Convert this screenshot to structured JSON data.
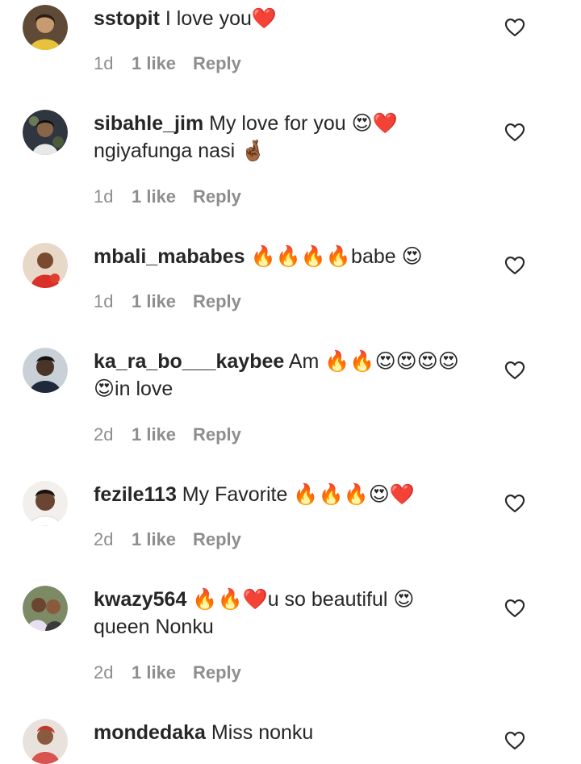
{
  "comments": [
    {
      "username": "sstopit",
      "text": " I love you❤️",
      "time": "1d",
      "likes": "1 like",
      "reply": "Reply",
      "avatar_color": "#7a5a3c"
    },
    {
      "username": "sibahle_jim",
      "text": " My love for you 😍❤️\nngiyafunga nasi 🤞🏾",
      "time": "1d",
      "likes": "1 like",
      "reply": "Reply",
      "avatar_color": "#3a4048"
    },
    {
      "username": "mbali_mababes",
      "text": " 🔥🔥🔥🔥babe 😍",
      "time": "1d",
      "likes": "1 like",
      "reply": "Reply",
      "avatar_color": "#c0392b"
    },
    {
      "username": "ka_ra_bo___kaybee",
      "text": " Am 🔥🔥😍😍😍😍\n😍in love",
      "time": "2d",
      "likes": "1 like",
      "reply": "Reply",
      "avatar_color": "#2c3e50"
    },
    {
      "username": "fezile113",
      "text": " My Favorite 🔥🔥🔥😍❤️",
      "time": "2d",
      "likes": "1 like",
      "reply": "Reply",
      "avatar_color": "#d9c9b6"
    },
    {
      "username": "kwazy564",
      "text": " 🔥🔥❤️u so beautiful 😍\nqueen Nonku",
      "time": "2d",
      "likes": "1 like",
      "reply": "Reply",
      "avatar_color": "#8a9a6a"
    },
    {
      "username": "mondedaka",
      "text": " Miss nonku",
      "time": "",
      "likes": "",
      "reply": "",
      "avatar_color": "#b85a3a"
    }
  ],
  "icons": {
    "like": "heart-outline-icon"
  }
}
